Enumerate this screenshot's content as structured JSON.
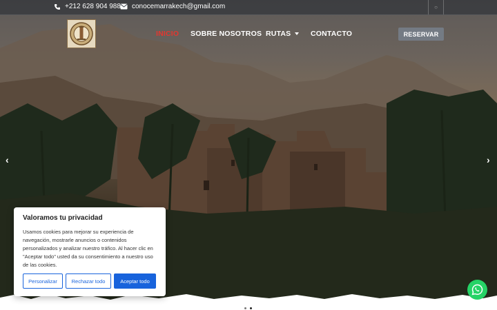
{
  "topbar": {
    "phone": "+212 628 904 988",
    "email": "conocemarrakech@gmail.com"
  },
  "nav": {
    "items": [
      {
        "label": "INICIO",
        "active": true
      },
      {
        "label": "SOBRE NOSOTROS",
        "active": false
      },
      {
        "label": "RUTAS",
        "active": false,
        "dropdown": true
      },
      {
        "label": "CONTACTO",
        "active": false
      }
    ],
    "reserve_label": "RESERVAR"
  },
  "slider": {
    "prev_icon": "chevron-left-icon",
    "next_icon": "chevron-right-icon",
    "dots_total": 2,
    "active_dot": 2
  },
  "cookie": {
    "title": "Valoramos tu privacidad",
    "text": "Usamos cookies para mejorar su experiencia de navegación, mostrarle anuncios o contenidos personalizados y analizar nuestro tráfico. Al hacer clic en \"Aceptar todo\" usted da su consentimiento a nuestro uso de las cookies.",
    "customize_label": "Personalizar",
    "reject_label": "Rechazar todo",
    "accept_label": "Aceptar todo"
  },
  "colors": {
    "accent_nav": "#e3372f",
    "reserve_button": "#747b84",
    "cookie_button": "#1863dc",
    "whatsapp": "#25d366"
  }
}
